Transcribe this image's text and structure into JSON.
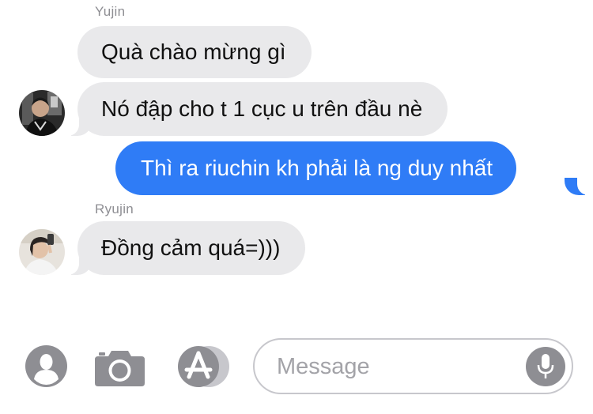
{
  "conversation": {
    "groups": [
      {
        "sender": "Yujin",
        "messages": [
          "Quà chào mừng gì",
          "Nó đập cho t 1 cục u trên đầu nè"
        ]
      },
      {
        "sender": "me",
        "messages": [
          "Thì ra riuchin kh phải là ng duy nhất"
        ]
      },
      {
        "sender": "Ryujin",
        "messages": [
          "Đồng cảm quá=)))"
        ]
      }
    ]
  },
  "composer": {
    "placeholder": "Message",
    "icons": [
      "contact-icon",
      "camera-icon",
      "app-store-icon",
      "microphone-icon"
    ]
  },
  "colors": {
    "outgoing_bubble": "#2f7cf6",
    "incoming_bubble": "#e9e9eb",
    "icon_gray": "#8e8e93"
  }
}
